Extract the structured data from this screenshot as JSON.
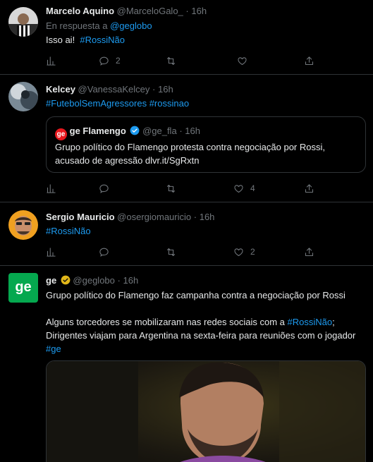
{
  "colors": {
    "background": "#000000",
    "text": "#e7e9ea",
    "muted": "#71767b",
    "link": "#1d9bf0",
    "border": "#2f3336",
    "ge_green": "#05a84f",
    "verified_blue": "#1d9bf0",
    "verified_gold": "#e2b719"
  },
  "tweets": [
    {
      "name": "Marcelo Aquino",
      "handle": "@MarceloGalo_",
      "dot": "·",
      "time": "16h",
      "reply_prefix": "En respuesta a",
      "reply_handle": "@geglobo",
      "text_prefix": "Isso ai!",
      "hashtag": "#RossiNão",
      "reply_count": "2",
      "like_count": ""
    },
    {
      "name": "Kelcey",
      "handle": "@VanessaKelcey",
      "dot": "·",
      "time": "16h",
      "hashtag_1": "#FutebolSemAgressores",
      "hashtag_2": "#rossinao",
      "like_count": "4",
      "quote": {
        "logo_text": "ge",
        "name": "ge Flamengo",
        "handle": "@ge_fla",
        "dot": "·",
        "time": "16h",
        "line_1": "Grupo político do Flamengo protesta contra negociação por Rossi,",
        "line_2": "acusado de agressão dlvr.it/SgRxtn"
      }
    },
    {
      "name": "Sergio Mauricio",
      "handle": "@osergiomauricio",
      "dot": "·",
      "time": "16h",
      "hashtag": "#RossiNão",
      "like_count": "2"
    },
    {
      "avatar_text": "ge",
      "name": "ge",
      "handle": "@geglobo",
      "dot": "·",
      "time": "16h",
      "line_1": "Grupo político do Flamengo faz campanha contra a negociação por Rossi",
      "line_2_prefix": "Alguns torcedores se mobilizaram nas redes sociais com a",
      "line_2_hashtag": "#RossiNão",
      "line_2_suffix": ";",
      "line_3": "Dirigentes viajam para Argentina na sexta-feira para reuniões com o jogador",
      "line_4_hashtag": "#ge"
    }
  ],
  "icons": {
    "views": "bar-chart-icon",
    "reply": "reply-icon",
    "retweet": "retweet-icon",
    "like": "heart-icon",
    "share": "share-icon",
    "verified": "verified-badge-icon"
  }
}
